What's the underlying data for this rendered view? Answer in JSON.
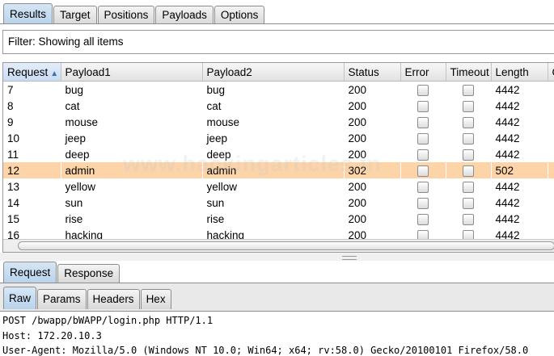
{
  "top_tabs": [
    "Results",
    "Target",
    "Positions",
    "Payloads",
    "Options"
  ],
  "filter": {
    "text": "Filter: Showing all items"
  },
  "table": {
    "columns": [
      "Request",
      "Payload1",
      "Payload2",
      "Status",
      "Error",
      "Timeout",
      "Length",
      "C"
    ],
    "sorted_column": "Request",
    "rows": [
      {
        "request": "7",
        "payload1": "bug",
        "payload2": "bug",
        "status": "200",
        "length": "4442",
        "highlight": false
      },
      {
        "request": "8",
        "payload1": "cat",
        "payload2": "cat",
        "status": "200",
        "length": "4442",
        "highlight": false
      },
      {
        "request": "9",
        "payload1": "mouse",
        "payload2": "mouse",
        "status": "200",
        "length": "4442",
        "highlight": false
      },
      {
        "request": "10",
        "payload1": "jeep",
        "payload2": "jeep",
        "status": "200",
        "length": "4442",
        "highlight": false
      },
      {
        "request": "11",
        "payload1": "deep",
        "payload2": "deep",
        "status": "200",
        "length": "4442",
        "highlight": false
      },
      {
        "request": "12",
        "payload1": "admin",
        "payload2": "admin",
        "status": "302",
        "length": "502",
        "highlight": true
      },
      {
        "request": "13",
        "payload1": "yellow",
        "payload2": "yellow",
        "status": "200",
        "length": "4442",
        "highlight": false
      },
      {
        "request": "14",
        "payload1": "sun",
        "payload2": "sun",
        "status": "200",
        "length": "4442",
        "highlight": false
      },
      {
        "request": "15",
        "payload1": "rise",
        "payload2": "rise",
        "status": "200",
        "length": "4442",
        "highlight": false
      },
      {
        "request": "16",
        "payload1": "hacking",
        "payload2": "hacking",
        "status": "200",
        "length": "4442",
        "highlight": false
      }
    ]
  },
  "watermark": "www.hackingarticles.in",
  "req_tabs": [
    "Request",
    "Response"
  ],
  "raw_tabs": [
    "Raw",
    "Params",
    "Headers",
    "Hex"
  ],
  "raw_lines": [
    "POST /bwapp/bWAPP/login.php HTTP/1.1",
    "Host: 172.20.10.3",
    "User-Agent: Mozilla/5.0 (Windows NT 10.0; Win64; x64; rv:58.0) Gecko/20100101 Firefox/58.0"
  ],
  "colors": {
    "highlight_row": "#fcd4a8",
    "active_tab": "#b9d3ec"
  }
}
